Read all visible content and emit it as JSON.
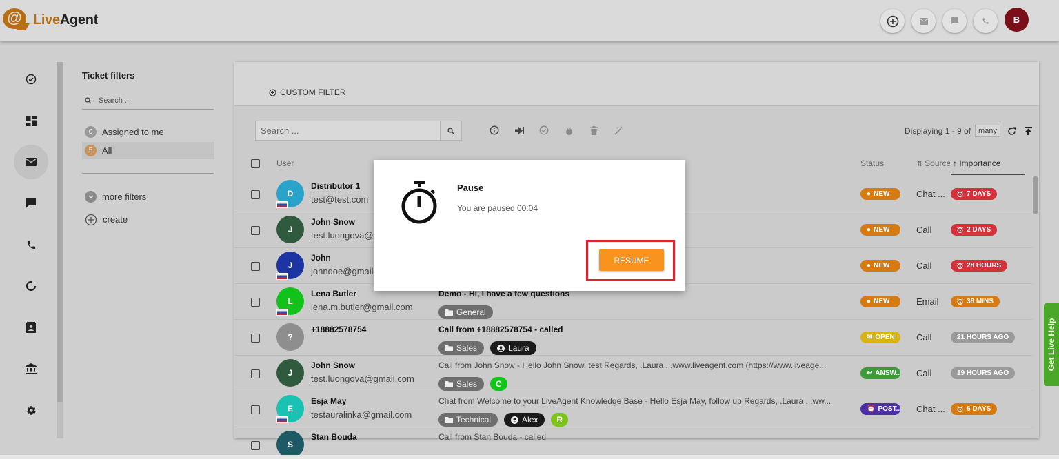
{
  "app": {
    "brand_live": "Live",
    "brand_agent": "Agent",
    "brand_color": "#b86f14"
  },
  "topbar": {
    "avatar_initial": "B",
    "icons": [
      "add-circle-icon",
      "mail-icon",
      "chat-icon",
      "phone-icon"
    ]
  },
  "leftnav": {
    "items": [
      "check-circle-icon",
      "dashboard-icon",
      "mail-icon",
      "chat-icon",
      "phone-icon",
      "reports-icon",
      "contacts-icon",
      "bank-icon",
      "gear-icon"
    ],
    "active": "mail-icon"
  },
  "filters": {
    "title": "Ticket filters",
    "search_placeholder": "Search ...",
    "items": [
      {
        "count": "0",
        "label": "Assigned to me"
      },
      {
        "count": "5",
        "label": "All"
      }
    ],
    "more": "more filters",
    "create": "create"
  },
  "main": {
    "custom_filter": "CUSTOM FILTER",
    "search_placeholder": "Search ...",
    "displaying": "Displaying 1 - 9 of",
    "many": "many",
    "columns": {
      "user": "User",
      "status": "Status",
      "source": "Source",
      "importance": "Importance"
    },
    "rows": [
      {
        "initial": "D",
        "color": "#29a3c9",
        "flag": true,
        "name": "Distributor 1",
        "email": "test@test.com",
        "subject": "",
        "bold": false,
        "tags": [],
        "status": "NEW",
        "status_color": "#d67a14",
        "source": "Chat ...",
        "importance": "7 DAYS",
        "imp_color": "#d5313b",
        "imp_icon": true
      },
      {
        "initial": "J",
        "color": "#2f5a3d",
        "flag": false,
        "name": "John Snow",
        "email": "test.luongova@gmail.com",
        "subject": "",
        "bold": false,
        "tags": [],
        "status": "NEW",
        "status_color": "#d67a14",
        "source": "Call",
        "importance": "2 DAYS",
        "imp_color": "#d5313b",
        "imp_icon": true
      },
      {
        "initial": "J",
        "color": "#1c35a3",
        "flag": true,
        "name": "John",
        "email": "johndoe@gmail.com",
        "subject": "",
        "bold": false,
        "tags": [],
        "status": "NEW",
        "status_color": "#d67a14",
        "source": "Call",
        "importance": "28 HOURS",
        "imp_color": "#d5313b",
        "imp_icon": true
      },
      {
        "initial": "L",
        "color": "#12c21a",
        "flag": true,
        "name": "Lena Butler",
        "email": "lena.m.butler@gmail.com",
        "subject": "Demo - Hi, I have a few questions",
        "bold": true,
        "tags": [
          {
            "type": "dept",
            "text": "General"
          }
        ],
        "status": "NEW",
        "status_color": "#d67a14",
        "source": "Email",
        "importance": "38 MINS",
        "imp_color": "#d67a14",
        "imp_icon": true
      },
      {
        "initial": "?",
        "color": "#8e8e8e",
        "flag": false,
        "name": "+18882578754",
        "email": "",
        "subject": "Call from +18882578754 - called",
        "bold": true,
        "tags": [
          {
            "type": "dept",
            "text": "Sales"
          },
          {
            "type": "agent",
            "text": "Laura"
          }
        ],
        "status": "OPEN",
        "status_color": "#d8b314",
        "source": "Call",
        "importance": "21 HOURS AGO",
        "imp_color": "#9a9a9a",
        "imp_icon": false
      },
      {
        "initial": "J",
        "color": "#2f5a3d",
        "flag": false,
        "name": "John Snow",
        "email": "test.luongova@gmail.com",
        "subject": "Call from John Snow - Hello John Snow, test Regards, .Laura . .www.liveagent.com (https://www.liveage...",
        "bold": false,
        "tags": [
          {
            "type": "dept",
            "text": "Sales"
          },
          {
            "type": "green",
            "text": "C"
          }
        ],
        "status": "ANSW...",
        "status_color": "#3e9b3a",
        "source": "Call",
        "importance": "19 HOURS AGO",
        "imp_color": "#9a9a9a",
        "imp_icon": false
      },
      {
        "initial": "E",
        "color": "#19c2b2",
        "flag": true,
        "name": "Esja May",
        "email": "testauralinka@gmail.com",
        "subject": "Chat from Welcome to your LiveAgent Knowledge Base - Hello Esja May, follow up Regards, .Laura . .ww...",
        "bold": false,
        "tags": [
          {
            "type": "dept",
            "text": "Technical"
          },
          {
            "type": "agent",
            "text": "Alex"
          },
          {
            "type": "lime",
            "text": "R"
          }
        ],
        "status": "POST...",
        "status_color": "#4b2fa6",
        "source": "Chat ...",
        "importance": "6 DAYS",
        "imp_color": "#d67a14",
        "imp_icon": true
      },
      {
        "initial": "S",
        "color": "#1d5a66",
        "flag": false,
        "name": "Stan Bouda",
        "email": "",
        "subject": "Call from Stan Bouda - called",
        "bold": false,
        "tags": [],
        "status": "",
        "status_color": "",
        "source": "",
        "importance": "",
        "imp_color": "",
        "imp_icon": false
      }
    ]
  },
  "modal": {
    "title": "Pause",
    "message": "You are paused 00:04",
    "button": "RESUME"
  },
  "live_help": "Get Live Help"
}
